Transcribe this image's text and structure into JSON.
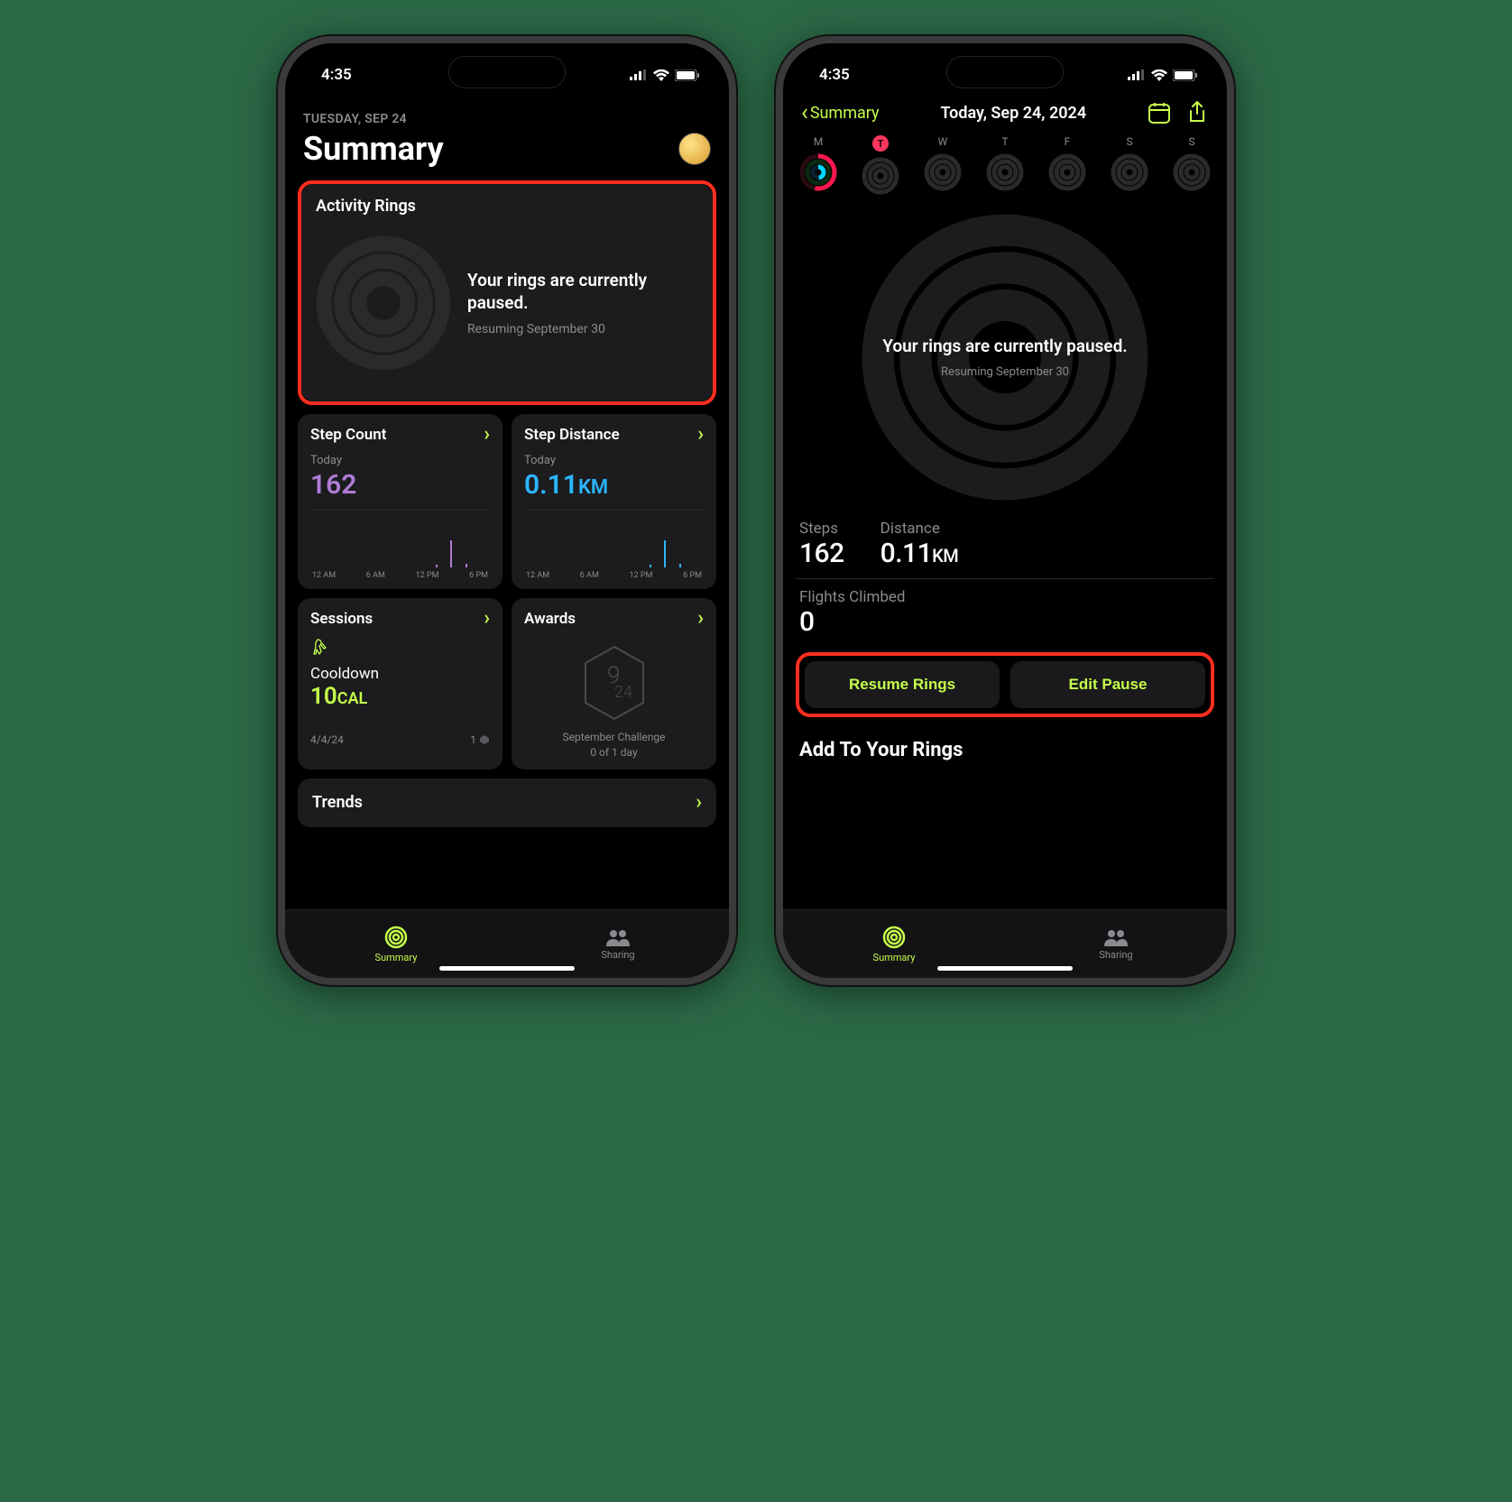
{
  "status": {
    "time": "4:35"
  },
  "phone1": {
    "date_label": "TUESDAY, SEP 24",
    "page_title": "Summary",
    "activity": {
      "title": "Activity Rings",
      "paused": "Your rings are currently paused.",
      "resuming": "Resuming September 30"
    },
    "step_count": {
      "title": "Step Count",
      "sub": "Today",
      "value": "162"
    },
    "step_distance": {
      "title": "Step Distance",
      "sub": "Today",
      "value": "0.11",
      "unit": "KM"
    },
    "chart_labels": [
      "12 AM",
      "6 AM",
      "12 PM",
      "6 PM"
    ],
    "sessions": {
      "title": "Sessions",
      "name": "Cooldown",
      "value": "10",
      "unit": "CAL",
      "date": "4/4/24",
      "count": "1"
    },
    "awards": {
      "title": "Awards",
      "name": "September Challenge",
      "progress": "0 of 1 day"
    },
    "trends": "Trends"
  },
  "phone2": {
    "back": "Summary",
    "nav_title": "Today, Sep 24, 2024",
    "week": [
      "M",
      "T",
      "W",
      "T",
      "F",
      "S",
      "S"
    ],
    "paused": "Your rings are currently paused.",
    "resuming": "Resuming September 30",
    "steps": {
      "label": "Steps",
      "value": "162"
    },
    "distance": {
      "label": "Distance",
      "value": "0.11",
      "unit": "KM"
    },
    "flights": {
      "label": "Flights Climbed",
      "value": "0"
    },
    "resume_btn": "Resume Rings",
    "edit_btn": "Edit Pause",
    "add_section": "Add To Your Rings"
  },
  "tabs": {
    "summary": "Summary",
    "sharing": "Sharing"
  }
}
